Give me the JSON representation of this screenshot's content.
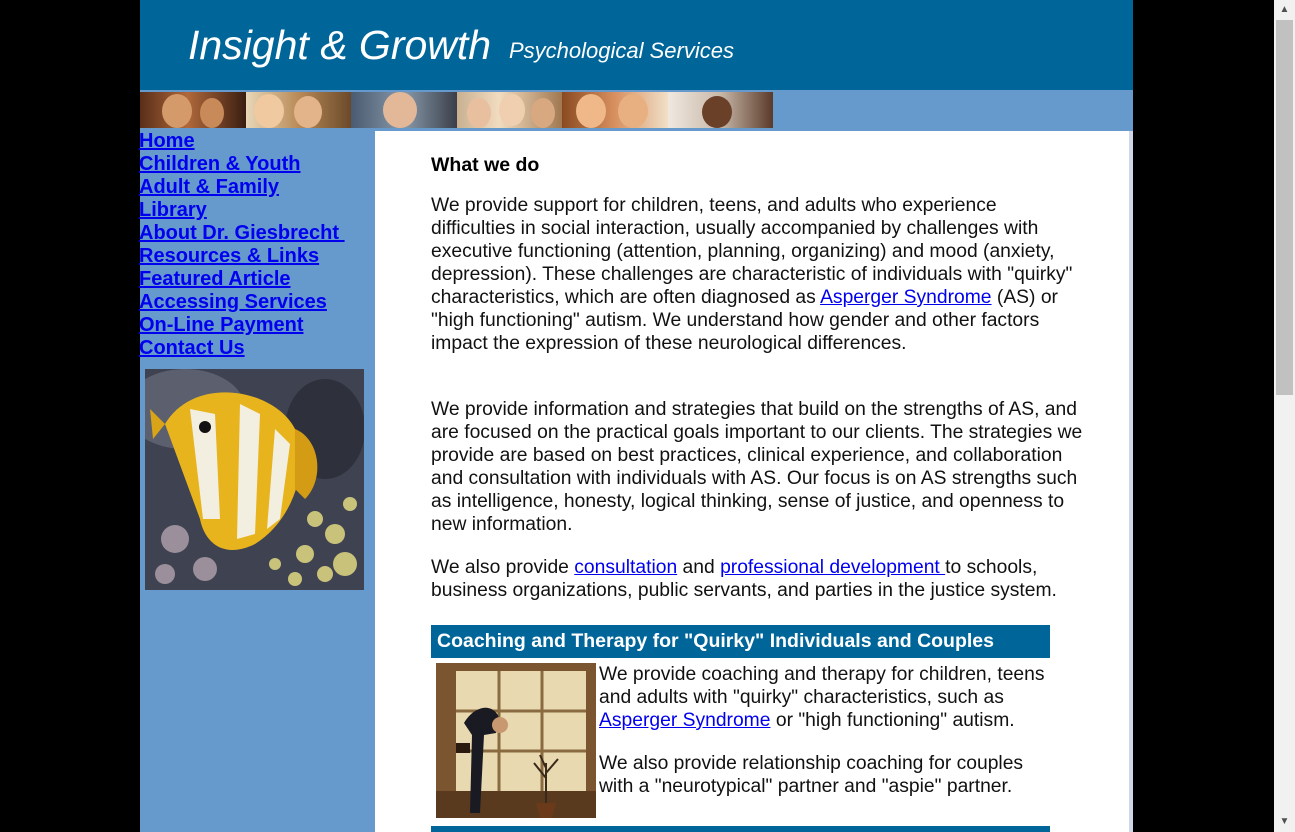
{
  "header": {
    "title": "Insight & Growth",
    "subtitle": "Psychological Services"
  },
  "nav": {
    "items": [
      "Home",
      "Children & Youth",
      "Adult & Family",
      "Library",
      "About Dr. Giesbrecht ",
      "Resources & Links",
      "Featured Article",
      "Accessing Services",
      "On-Line Payment",
      "Contact Us"
    ]
  },
  "content": {
    "heading": "What we do",
    "p1": {
      "before": "We provide support for children, teens, and adults who experience difficulties in social interaction, usually accompanied by challenges with executive functioning (attention, planning, organizing) and mood (anxiety, depression). These challenges are characteristic of individuals with \"quirky\" characteristics, which are often diagnosed as ",
      "link": "Asperger Syndrome",
      "after": " (AS) or \"high functioning\" autism. We understand how gender and other factors impact the expression of these neurological differences."
    },
    "p2": "We provide information and strategies that build on the strengths of AS, and are focused on the practical goals important to our clients.  The strategies we provide are based on best practices, clinical experience, and collaboration and consultation with individuals with AS. Our focus is on AS strengths such as intelligence, honesty, logical thinking,  sense of justice, and openness to new information.",
    "p3": {
      "before": "We also provide ",
      "link1": "consultation",
      "mid": " and ",
      "link2": "professional development ",
      "after": "to schools, business organizations, public servants, and parties in the justice system."
    },
    "section_title": "Coaching and Therapy for \"Quirky\" Individuals and Couples",
    "coach": {
      "before": "We provide coaching and therapy for children, teens and adults with \"quirky\" characteristics, such as ",
      "link": "Asperger Syndrome",
      "after": " or \"high functioning\" autism.",
      "p2": "We also provide relationship coaching for couples with a \"neurotypical\" partner and \"aspie\" partner."
    }
  },
  "colors": {
    "header_bg": "#006699",
    "sidebar_bg": "#6699cc",
    "link": "#0000ee"
  }
}
